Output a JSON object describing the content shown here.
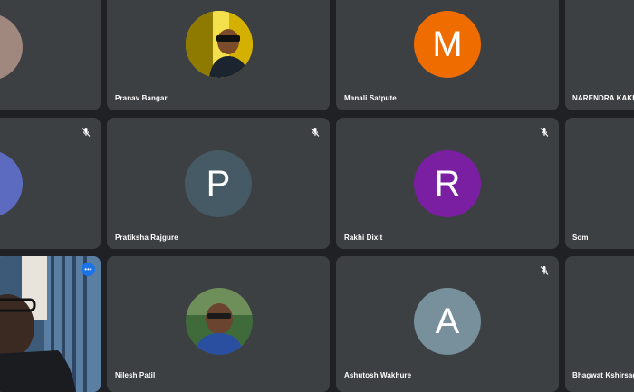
{
  "participants": {
    "r1c0": {
      "name": "",
      "color": "#a1887f"
    },
    "pranav": {
      "name": "Pranav Bangar"
    },
    "manali": {
      "name": "Manali Satpute",
      "initial": "M",
      "color": "#ef6c00"
    },
    "narendra": {
      "name": "NARENDRA KAKDE"
    },
    "r2c0": {
      "name": "",
      "color": "#5c6bc0"
    },
    "pratiksha": {
      "name": "Pratiksha Rajgure",
      "initial": "P",
      "color": "#455a64"
    },
    "rakhi": {
      "name": "Rakhi Dixit",
      "initial": "R",
      "color": "#7b1fa2"
    },
    "som": {
      "name": "Som"
    },
    "nilesh": {
      "name": "Nilesh Patil"
    },
    "ashutosh": {
      "name": "Ashutosh Wakhure",
      "initial": "A",
      "color": "#78909c"
    },
    "bhagwat": {
      "name": "Bhagwat Kshirsagar"
    }
  },
  "icons": {
    "mic_muted": "mic-off-icon",
    "more_options": "more-options-icon"
  }
}
